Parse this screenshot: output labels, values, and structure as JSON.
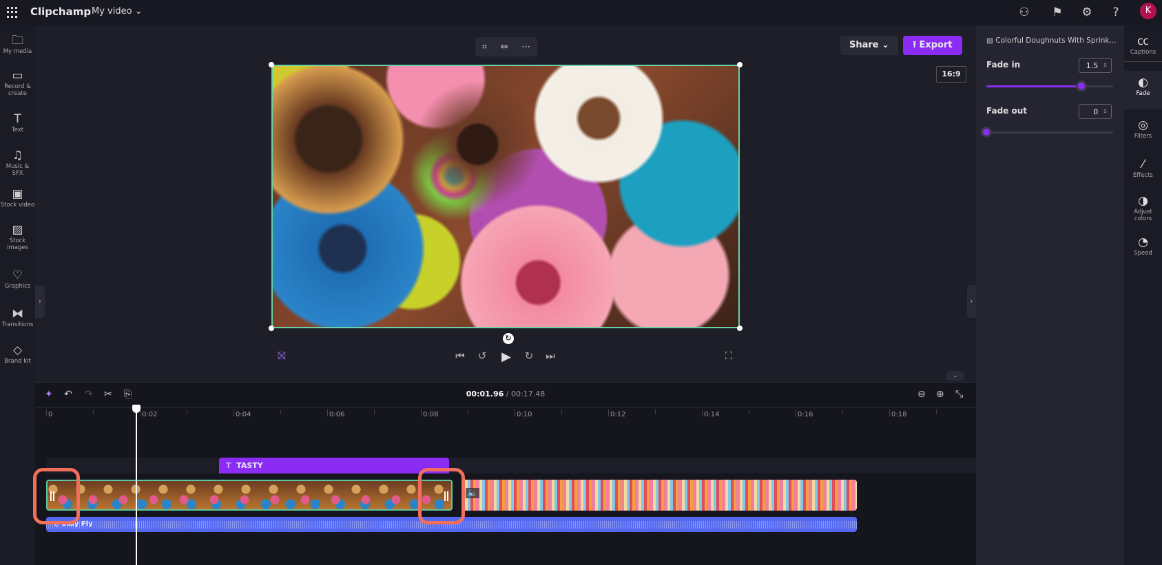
{
  "topbar": {
    "brand": "Clipchamp",
    "project_title": "My video",
    "avatar_initial": "K",
    "icons": [
      "apps-grid-icon",
      "community-icon",
      "flag-icon",
      "settings-gear-icon",
      "help-icon"
    ]
  },
  "left_nav": [
    {
      "label": "My media",
      "icon": "folder-icon"
    },
    {
      "label": "Record & create",
      "icon": "camera-icon"
    },
    {
      "label": "Text",
      "icon": "text-icon"
    },
    {
      "label": "Music & SFX",
      "icon": "music-icon"
    },
    {
      "label": "Stock video",
      "icon": "film-icon"
    },
    {
      "label": "Stock images",
      "icon": "image-icon"
    },
    {
      "label": "Graphics",
      "icon": "shapes-icon"
    },
    {
      "label": "Transitions",
      "icon": "transitions-icon"
    },
    {
      "label": "Brand kit",
      "icon": "brand-kit-icon"
    }
  ],
  "preview": {
    "share_label": "Share",
    "export_label": "Export",
    "aspect_ratio": "16:9"
  },
  "properties": {
    "clip_title": "Colorful Doughnuts With Sprink...",
    "fade_in": {
      "label": "Fade in",
      "value": "1.5",
      "unit": "s",
      "level": 0.75
    },
    "fade_out": {
      "label": "Fade out",
      "value": "0",
      "unit": "s",
      "level": 0
    }
  },
  "right_nav": [
    {
      "label": "Captions",
      "icon": "cc-icon"
    },
    {
      "label": "Fade",
      "icon": "fade-icon",
      "active": true
    },
    {
      "label": "Filters",
      "icon": "filters-icon"
    },
    {
      "label": "Effects",
      "icon": "magic-wand-icon"
    },
    {
      "label": "Adjust colors",
      "icon": "contrast-icon"
    },
    {
      "label": "Speed",
      "icon": "speedometer-icon"
    }
  ],
  "timeline": {
    "current_time": "00:01.96",
    "total_time": "/ 00:17.48",
    "ruler": [
      "0",
      "0:02",
      "0:04",
      "0:06",
      "0:08",
      "0:10",
      "0:12",
      "0:14",
      "0:16",
      "0:18"
    ],
    "text_clip": "TASTY",
    "audio_clip": "Stay Fly"
  },
  "colors": {
    "accent": "#8b2cf5",
    "clip_border": "#5dc79f",
    "audio": "#5468f0",
    "highlight": "#f26f5b"
  }
}
